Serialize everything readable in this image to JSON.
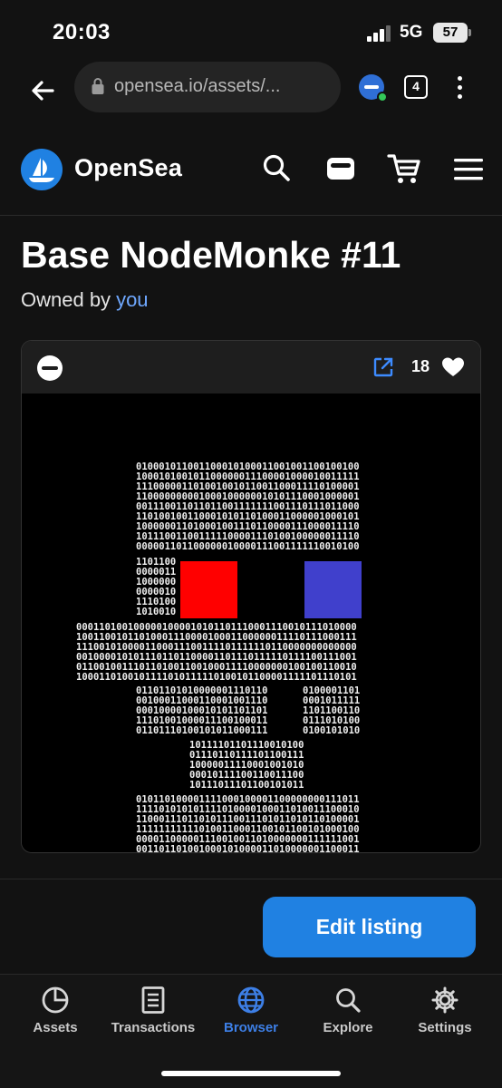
{
  "status_bar": {
    "time": "20:03",
    "network": "5G",
    "battery": "57"
  },
  "browser": {
    "url": "opensea.io/assets/...",
    "tab_count": "4"
  },
  "site": {
    "name": "OpenSea"
  },
  "asset": {
    "title": "Base NodeMonke #11",
    "owned_by_label": "Owned by",
    "owner": "you",
    "favorites": "18"
  },
  "actions": {
    "edit_listing": "Edit listing"
  },
  "nav": {
    "items": [
      {
        "label": "Assets",
        "icon": "pie-chart-icon"
      },
      {
        "label": "Transactions",
        "icon": "receipt-icon"
      },
      {
        "label": "Browser",
        "icon": "globe-icon"
      },
      {
        "label": "Explore",
        "icon": "search-icon"
      },
      {
        "label": "Settings",
        "icon": "gear-icon"
      }
    ],
    "active_index": 2
  },
  "colors": {
    "accent": "#2081e2",
    "active_nav": "#3d7fe6",
    "owner_link": "#6fa8ff",
    "eye_left": "#ff0000",
    "eye_right": "#4040cc"
  }
}
